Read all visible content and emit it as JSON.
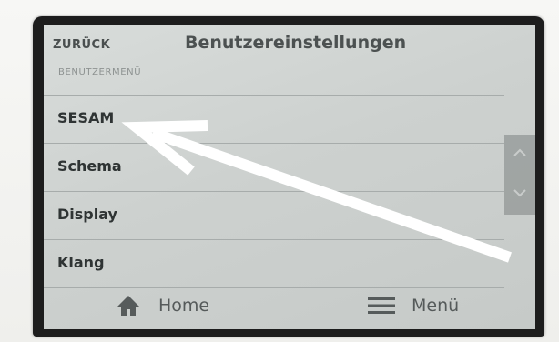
{
  "header": {
    "back_label": "ZURÜCK",
    "title": "Benutzereinstellungen"
  },
  "section_label": "BENUTZERMENÜ",
  "menu_items": [
    {
      "label": "SESAM"
    },
    {
      "label": "Schema"
    },
    {
      "label": "Display"
    },
    {
      "label": "Klang"
    }
  ],
  "footer": {
    "home_label": "Home",
    "menu_label": "Menü"
  },
  "icons": {
    "home": "home-icon",
    "menu": "hamburger-icon",
    "scroll_up": "chevron-up-icon",
    "scroll_down": "chevron-down-icon",
    "annotation": "arrow-annotation"
  },
  "colors": {
    "screen_bg": "#d2d6d4",
    "bezel": "#1d1d1d",
    "text": "#2f3434",
    "annotation_arrow": "#ffffff"
  }
}
